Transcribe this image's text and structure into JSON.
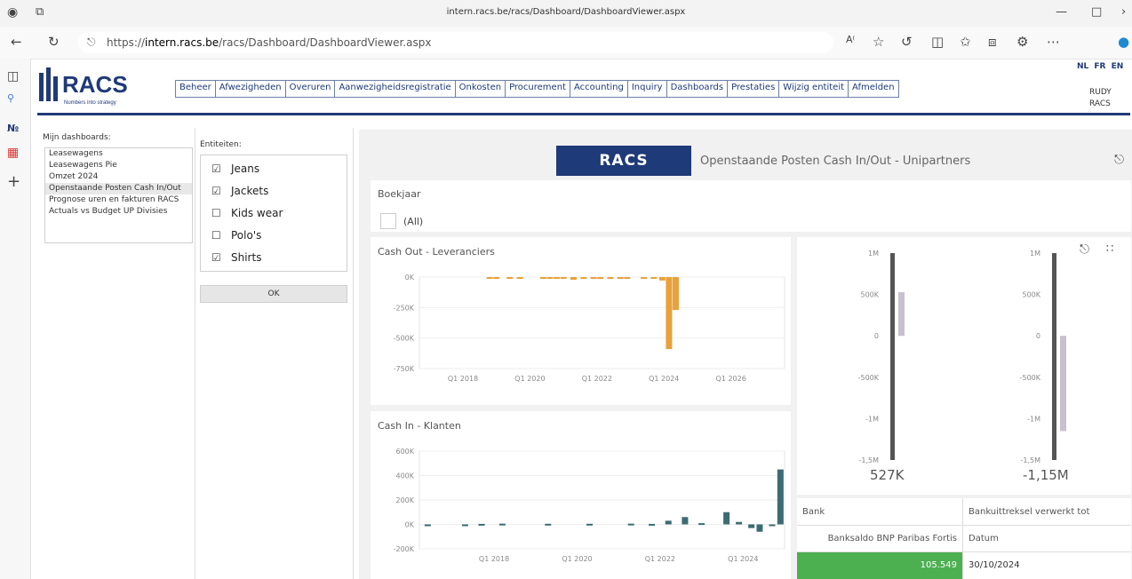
{
  "browser": {
    "tab_title": "intern.racs.be/racs/Dashboard/DashboardViewer.aspx",
    "url_prefix": "https://",
    "url_domain": "intern.racs.be",
    "url_path": "/racs/Dashboard/DashboardViewer.aspx"
  },
  "app": {
    "logo_text": "RACS",
    "logo_tagline": "Numbers into strategy",
    "menu": [
      "Beheer",
      "Afwezigheden",
      "Overuren",
      "Aanwezigheidsregistratie",
      "Onkosten",
      "Procurement",
      "Accounting",
      "Inquiry",
      "Dashboards",
      "Prestaties",
      "Wijzig entiteit",
      "Afmelden"
    ],
    "languages": "NL FR EN",
    "user_line1": "RUDY",
    "user_line2": "RACS"
  },
  "dashboards": {
    "label": "Mijn dashboards:",
    "items": [
      "Leasewagens",
      "Leasewagens Pie",
      "Omzet 2024",
      "Openstaande Posten Cash In/Out",
      "Prognose uren en fakturen RACS",
      "Actuals vs Budget UP Divisies"
    ],
    "selected_index": 3
  },
  "entities": {
    "label": "Entiteiten:",
    "items": [
      {
        "label": "Jeans",
        "checked": true
      },
      {
        "label": "Jackets",
        "checked": true
      },
      {
        "label": "Kids wear",
        "checked": false
      },
      {
        "label": "Polo's",
        "checked": false
      },
      {
        "label": "Shirts",
        "checked": true
      }
    ],
    "ok_label": "OK"
  },
  "dashboard": {
    "logo_text": "RACS",
    "title": "Openstaande Posten Cash In/Out - Unipartners",
    "filter_label": "Boekjaar",
    "filter_value": "(All)",
    "gauge1_value": "527K",
    "gauge2_value": "-1,15M",
    "table": {
      "col1_header": "Bank",
      "col1_sub": "Banksaldo BNP Paribas Fortis",
      "col1_value": "105.549",
      "col2_header": "Bankuittreksel verwerkt tot",
      "col2_sub": "Datum",
      "col2_value": "30/10/2024"
    },
    "accent_green": "#4caf50",
    "bar_orange": "#e8a13c",
    "bar_teal": "#3d6b73",
    "bar_lilac": "#c9bfcf"
  },
  "chart_data": [
    {
      "type": "bar",
      "title": "Cash Out - Leveranciers",
      "xticks": [
        "Q1 2018",
        "Q1 2020",
        "Q1 2022",
        "Q1 2024",
        "Q1 2026"
      ],
      "ytick_labels": [
        "0K",
        "-250K",
        "-500K",
        "-750K"
      ],
      "ylim": [
        -750000,
        0
      ],
      "x_range": [
        2016.7,
        2027.6
      ],
      "grid": true,
      "color": "#e8a13c",
      "x": [
        2018.8,
        2019.0,
        2019.4,
        2019.7,
        2020.4,
        2020.6,
        2020.8,
        2021.0,
        2021.3,
        2021.6,
        2021.9,
        2022.1,
        2022.4,
        2022.7,
        2022.9,
        2023.4,
        2023.7,
        2023.95,
        2024.15,
        2024.35
      ],
      "values": [
        -3000,
        -4000,
        -3000,
        -5000,
        -4000,
        -3000,
        -15000,
        -12000,
        -22000,
        -6000,
        -5000,
        -4000,
        -6000,
        -5000,
        -4000,
        -3000,
        -12000,
        -28000,
        -590000,
        -270000
      ]
    },
    {
      "type": "bar",
      "title": "Cash In - Klanten",
      "xticks": [
        "Q1 2018",
        "Q1 2020",
        "Q1 2022",
        "Q1 2024"
      ],
      "ytick_labels": [
        "600K",
        "400K",
        "200K",
        "0K",
        "-200K"
      ],
      "ylim": [
        -200000,
        600000
      ],
      "x_range": [
        2016.2,
        2025.0
      ],
      "grid": true,
      "color": "#3d6b73",
      "x": [
        2016.4,
        2017.3,
        2017.7,
        2018.2,
        2019.3,
        2020.3,
        2021.3,
        2021.8,
        2022.2,
        2022.6,
        2023.0,
        2023.6,
        2023.9,
        2024.2,
        2024.4,
        2024.7,
        2024.9
      ],
      "values": [
        -6000,
        -5000,
        4000,
        6000,
        5000,
        5000,
        6000,
        4000,
        30000,
        60000,
        10000,
        100000,
        20000,
        -30000,
        -60000,
        -10000,
        450000
      ]
    },
    {
      "type": "bar",
      "title": "",
      "ytick_labels": [
        "1M",
        "500K",
        "0",
        "-500K",
        "-1M",
        "-1,5M"
      ],
      "ylim": [
        -1500000,
        1000000
      ],
      "colors": [
        "#555555",
        "#c9bfcf"
      ],
      "values": [
        527000
      ]
    },
    {
      "type": "bar",
      "title": "",
      "ytick_labels": [
        "1M",
        "500K",
        "0",
        "-500K",
        "-1M",
        "-1,5M"
      ],
      "ylim": [
        -1500000,
        1000000
      ],
      "colors": [
        "#555555",
        "#c9bfcf"
      ],
      "values": [
        -1150000
      ]
    }
  ]
}
